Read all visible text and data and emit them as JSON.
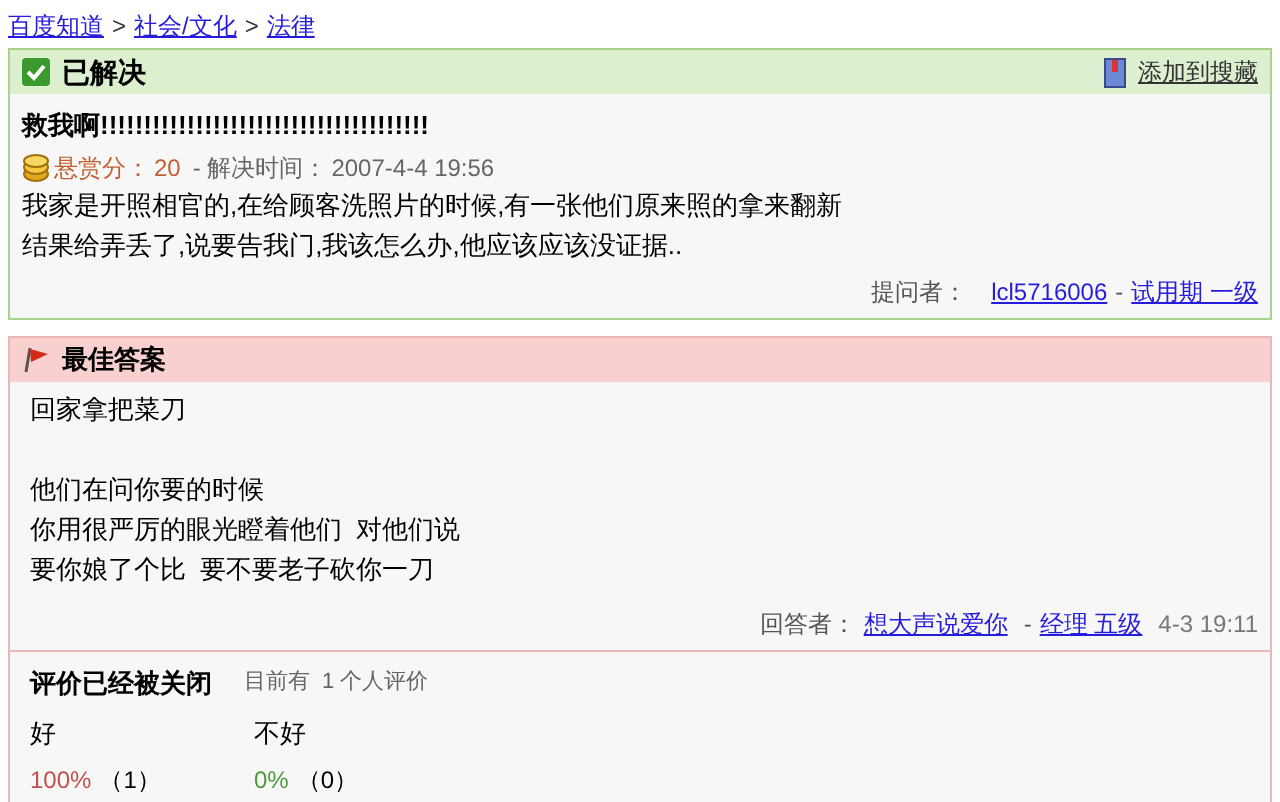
{
  "breadcrumb": [
    {
      "label": "百度知道"
    },
    {
      "label": "社会/文化",
      "sep": ">"
    },
    {
      "label": "法律",
      "sep": ">"
    }
  ],
  "question": {
    "status": "已解决",
    "favorite": "添加到搜藏",
    "title": "救我啊!!!!!!!!!!!!!!!!!!!!!!!!!!!!!!!!!!!!!!",
    "reward_label": "悬赏分：",
    "reward": "20",
    "solved_label": "- 解决时间：",
    "solved_time": "2007-4-4 19:56",
    "body": [
      "我家是开照相官的,在给顾客洗照片的时候,有一张他们原来照的拿来翻新",
      "结果给弄丢了,说要告我门,我该怎么办,他应该应该没证据.."
    ],
    "asker_label": "提问者：",
    "asker": "lcl5716006",
    "asker_sep": "-",
    "asker_level": "试用期 一级"
  },
  "answer": {
    "title": "最佳答案",
    "paragraphs": [
      [
        "回家拿把菜刀"
      ],
      [
        "他们在问你要的时候",
        "你用很严厉的眼光瞪着他们  对他们说",
        "要你娘了个比  要不要老子砍你一刀"
      ]
    ],
    "answerer_label": "回答者：",
    "answerer": "想大声说爱你",
    "answerer_sep": "-",
    "answerer_level": "经理 五级",
    "time": "4-3 19:11"
  },
  "rating": {
    "title": "评价已经被关闭",
    "count_label": "目前有",
    "count": "1 个人评价",
    "options": [
      {
        "label": "好",
        "percent": "100%",
        "votes": "（1）",
        "color": "#c0504d"
      },
      {
        "label": "不好",
        "percent": "0%",
        "votes": "（0）",
        "color": "#4a9a3a"
      }
    ]
  }
}
